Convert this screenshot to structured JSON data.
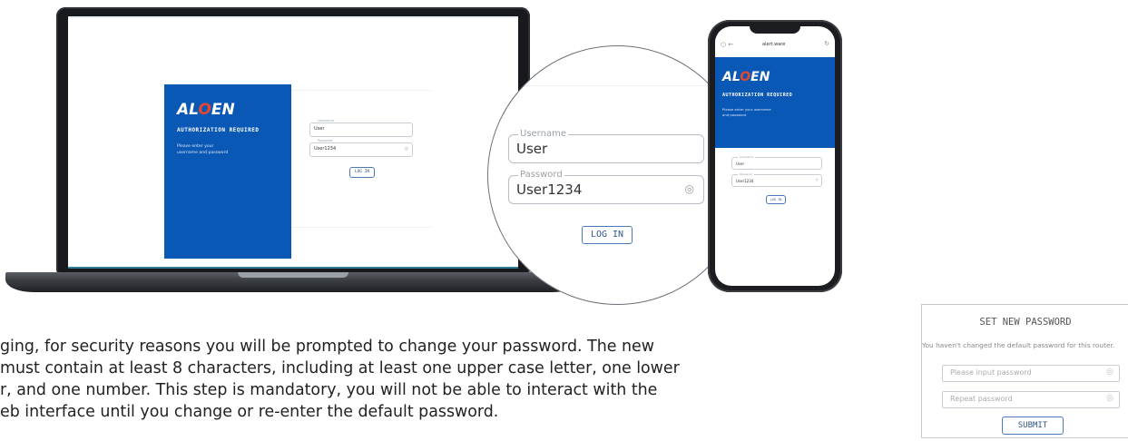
{
  "brand": {
    "logo_pre": "AL",
    "logo_mid": "O",
    "logo_post": "EN"
  },
  "login": {
    "title": "AUTHORIZATION REQUIRED",
    "subtitle_line1": "Please enter your",
    "subtitle_line2": "username and password",
    "username_label": "Username",
    "username_value": "User",
    "password_label": "Password",
    "password_value": "User1234",
    "login_button": "LOG IN"
  },
  "phone": {
    "url": "alert.ware",
    "subtitle_line1": "Please enter your username",
    "subtitle_line2": "and password",
    "username_label": "Username",
    "password_label": "Password"
  },
  "paragraph": {
    "lines": [
      "ging, for security reasons you will be prompted to change your password. The new",
      " must contain at least 8 characters, including at least one upper case letter, one lower",
      "r, and one number. This step is mandatory, you will not be able to interact with the",
      "eb interface until you change or re-enter the default password."
    ]
  },
  "set_password": {
    "title": "SET NEW PASSWORD",
    "message": "You haven't changed the default password for this router.",
    "password_placeholder": "Please input password",
    "repeat_placeholder": "Repeat password",
    "submit": "SUBMIT"
  },
  "colors": {
    "brand_blue": "#0a58b5",
    "accent_red": "#e8462f"
  },
  "icons": {
    "eye": "eye-icon",
    "reload": "reload-icon",
    "back": "back-arrow-icon"
  }
}
